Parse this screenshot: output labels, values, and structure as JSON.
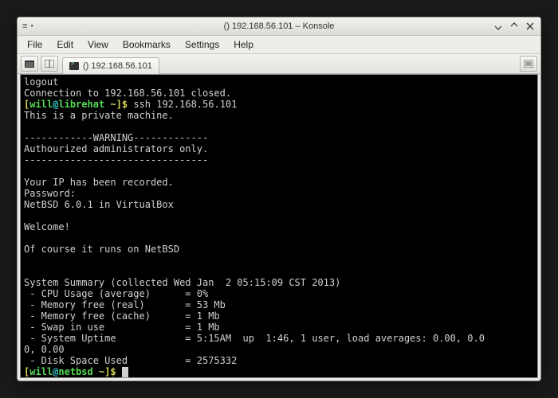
{
  "window": {
    "title": "() 192.168.56.101 – Konsole"
  },
  "menubar": {
    "file": "File",
    "edit": "Edit",
    "view": "View",
    "bookmarks": "Bookmarks",
    "settings": "Settings",
    "help": "Help"
  },
  "tab": {
    "label": "() 192.168.56.101"
  },
  "term": {
    "l1": "logout",
    "l2": "Connection to 192.168.56.101 closed.",
    "p1_open": "[",
    "p1_user": "will",
    "p1_at": "@",
    "p1_host": "librehat",
    "p1_sp": " ",
    "p1_dir": "~",
    "p1_close": "]$ ",
    "p1_cmd": "ssh 192.168.56.101",
    "l4": "This is a private machine.",
    "l5": "",
    "l6": "------------WARNING-------------",
    "l7": "Authourized administrators only.",
    "l8": "--------------------------------",
    "l9": "",
    "l10": "Your IP has been recorded.",
    "l11": "Password:",
    "l12": "NetBSD 6.0.1 in VirtualBox",
    "l13": "",
    "l14": "Welcome!",
    "l15": "",
    "l16": "Of course it runs on NetBSD",
    "l17": "",
    "l18": "",
    "l19": "System Summary (collected Wed Jan  2 05:15:09 CST 2013)",
    "l20": " - CPU Usage (average)      = 0%",
    "l21": " - Memory free (real)       = 53 Mb",
    "l22": " - Memory free (cache)      = 1 Mb",
    "l23": " - Swap in use              = 1 Mb",
    "l24": " - System Uptime            = 5:15AM  up  1:46, 1 user, load averages: 0.00, 0.0",
    "l25": "0, 0.00",
    "l26": " - Disk Space Used          = 2575332",
    "p2_open": "[",
    "p2_user": "will",
    "p2_at": "@",
    "p2_host": "netbsd",
    "p2_sp": " ",
    "p2_dir": "~",
    "p2_close": "]$ "
  }
}
